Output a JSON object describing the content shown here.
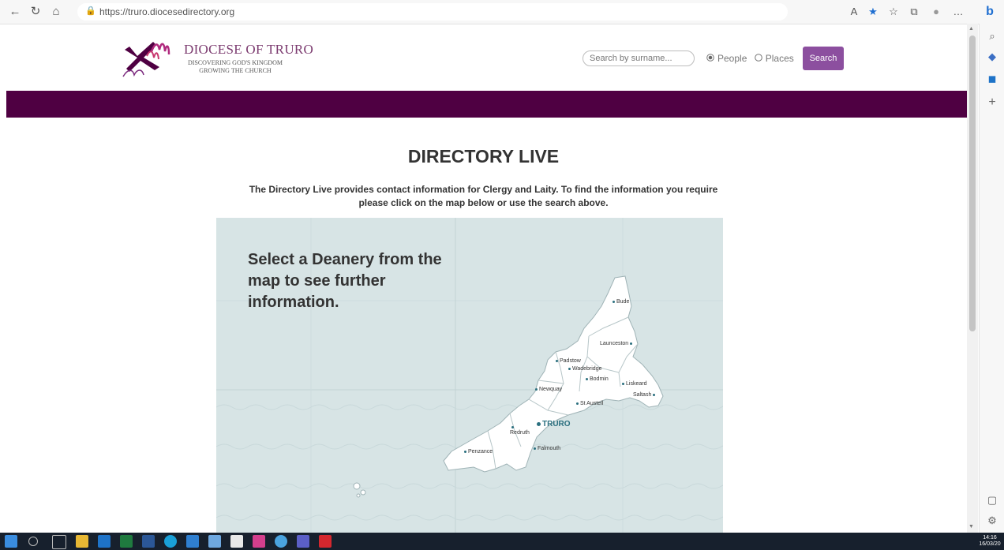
{
  "browser": {
    "url": "https://truro.diocesedirectory.org",
    "back_icon": "←",
    "refresh_icon": "↻",
    "home_icon": "⌂",
    "lock_icon": "🔒",
    "read_aloud_icon": "A",
    "favorite_icon": "★",
    "favorites_bar_icon": "☆",
    "collections_icon": "⧉",
    "profile_icon": "●",
    "more_icon": "…",
    "bing_icon": "b"
  },
  "edge_sidebar": {
    "search_icon": "⌕",
    "games_icon": "◆",
    "outlook_icon": "◼",
    "add_icon": "+",
    "panel_icon": "▢",
    "settings_icon": "⚙"
  },
  "header": {
    "logo_title": "DIOCESE OF TRURO",
    "logo_tag_line1": "DISCOVERING GOD'S KINGDOM",
    "logo_tag_line2": "GROWING THE CHURCH",
    "search_placeholder": "Search by surname...",
    "radio_people": "People",
    "radio_places": "Places",
    "search_button": "Search"
  },
  "colors": {
    "brand_purple": "#4f0042",
    "button_purple": "#8c4f9f",
    "map_teal": "#2a6f7f",
    "map_background": "#d7e4e5"
  },
  "main": {
    "title": "DIRECTORY LIVE",
    "intro": "The Directory Live provides contact information for Clergy and Laity. To find the information you require please click on the map below or use the search above.",
    "map_heading": "Select a Deanery from the map to see further information.",
    "deaneries": [
      "Bude",
      "Launceston",
      "Padstow",
      "Wadebridge",
      "Bodmin",
      "Liskeard",
      "Saltash",
      "Newquay",
      "St Austell",
      "TRURO",
      "Redruth",
      "Falmouth",
      "Penzance"
    ]
  },
  "taskbar": {
    "clock_time": "14:16",
    "clock_date": "16/03/20"
  }
}
